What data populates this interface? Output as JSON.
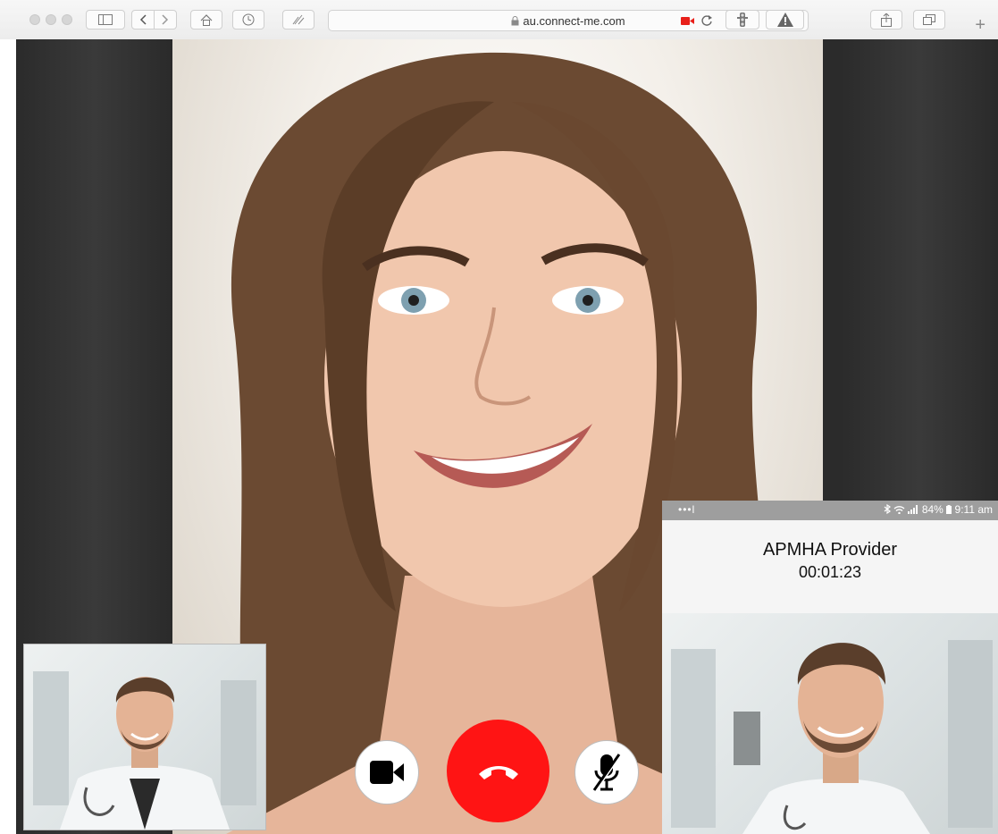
{
  "browser": {
    "url": "au.connect-me.com",
    "icons": [
      "sidebar-icon",
      "back-icon",
      "forward-icon",
      "home-icon",
      "history-icon",
      "extension-icon",
      "lock-icon",
      "camera-recording-icon",
      "reload-icon",
      "traffic-light-icon",
      "warning-icon",
      "share-icon",
      "tabs-icon",
      "plus-icon"
    ],
    "new_tab_label": "+"
  },
  "call": {
    "controls": [
      {
        "name": "camera-button",
        "icon": "video-camera-icon",
        "color": "#000000"
      },
      {
        "name": "hang-up-button",
        "icon": "phone-hangup-icon",
        "color": "#ff1414"
      },
      {
        "name": "mute-button",
        "icon": "microphone-muted-icon",
        "color": "#000000"
      }
    ]
  },
  "phone": {
    "status_bar": {
      "signal_dots": "•••l",
      "battery": "84%",
      "time": "9:11 am"
    },
    "provider_name": "APMHA Provider",
    "timer": "00:01:23"
  },
  "colors": {
    "hangup": "#ff1414",
    "stage_background": "#2b2b2b",
    "phone_status_bar": "#9e9e9e"
  }
}
